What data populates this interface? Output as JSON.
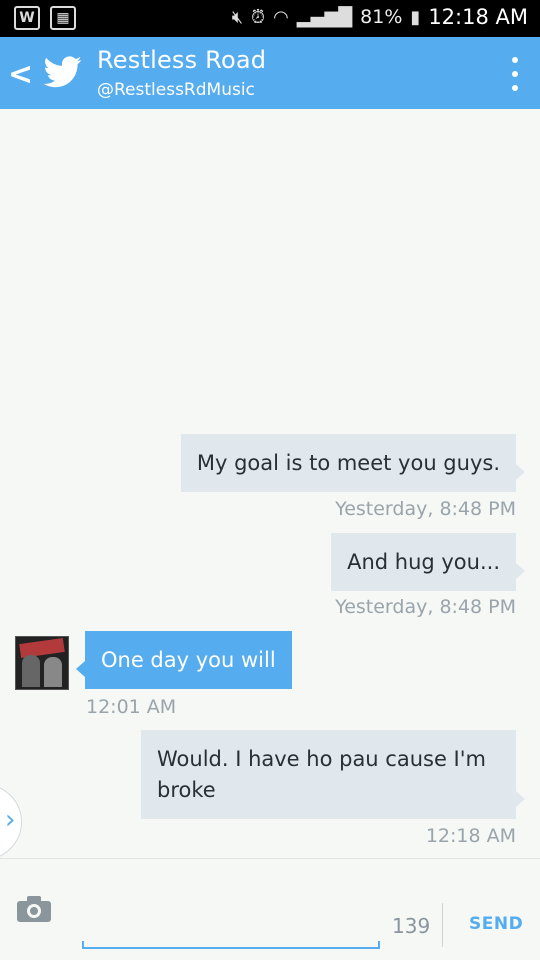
{
  "status_bar": {
    "battery": "81%",
    "time": "12:18 AM",
    "icons": [
      "app-w-icon",
      "calendar-icon",
      "mute-icon",
      "alarm-icon",
      "wifi-icon",
      "signal-icon",
      "battery-charging-icon"
    ]
  },
  "header": {
    "name": "Restless Road",
    "handle": "@RestlessRdMusic",
    "color": "#55acee"
  },
  "messages": [
    {
      "direction": "out",
      "text": "My goal is to meet you guys.",
      "time": "Yesterday, 8:48 PM"
    },
    {
      "direction": "out",
      "text": "And hug you...",
      "time": "Yesterday, 8:48 PM"
    },
    {
      "direction": "in",
      "text": "One day you will",
      "time": "12:01 AM"
    },
    {
      "direction": "out",
      "text": "Would. I have ho pau cause I'm broke",
      "time": "12:18 AM"
    }
  ],
  "compose": {
    "char_count": "139",
    "send_label": "SEND"
  }
}
